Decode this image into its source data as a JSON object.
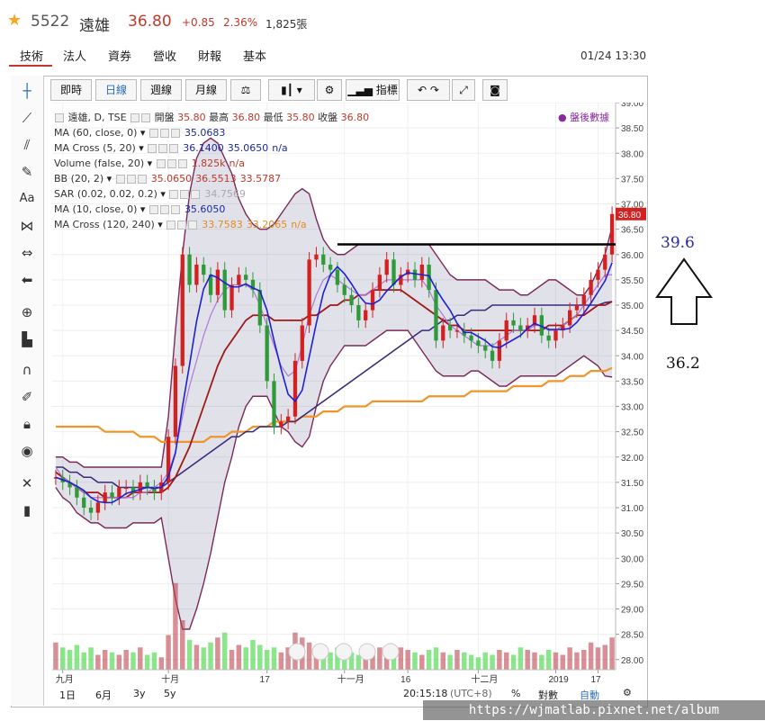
{
  "header": {
    "code": "5522",
    "name": "遠雄",
    "price": "36.80",
    "change": "+0.85",
    "pct": "2.36%",
    "volume": "1,825張",
    "timestamp": "01/24 13:30"
  },
  "tabs": [
    "技術",
    "法人",
    "資券",
    "營收",
    "財報",
    "基本"
  ],
  "toolbar": {
    "buttons": [
      "即時",
      "日線",
      "週線",
      "月線"
    ],
    "indicators": "指標"
  },
  "legend": {
    "title_name": "遠雄, D, TSE",
    "open_l": "開盤",
    "open_v": "35.80",
    "high_l": "最高",
    "high_v": "36.80",
    "low_l": "最低",
    "low_v": "35.80",
    "close_l": "收盤",
    "close_v": "36.80",
    "rows": [
      {
        "label": "MA (60, close, 0)",
        "values": [
          "35.0683"
        ],
        "cls": "vb"
      },
      {
        "label": "MA Cross (5, 20)",
        "values": [
          "36.1400",
          "35.0650",
          "n/a"
        ],
        "cls": "vb"
      },
      {
        "label": "Volume (false, 20)",
        "values": [
          "1.825k",
          "n/a"
        ],
        "cls": "v"
      },
      {
        "label": "BB (20, 2)",
        "values": [
          "35.0650",
          "36.5513",
          "33.5787"
        ],
        "cls": "v"
      },
      {
        "label": "SAR (0.02, 0.02, 0.2)",
        "values": [
          "34.7569"
        ],
        "cls": "vg"
      },
      {
        "label": "MA (10, close, 0)",
        "values": [
          "35.6050"
        ],
        "cls": "vb"
      },
      {
        "label": "MA Cross (120, 240)",
        "values": [
          "33.7583",
          "33.2065",
          "n/a"
        ],
        "cls": "vo"
      }
    ],
    "after_hours": "盤後數據"
  },
  "annotations": {
    "upper": "39.6",
    "lower": "36.2"
  },
  "bottom": {
    "ranges": [
      "1日",
      "6月",
      "3y",
      "5y"
    ],
    "time": "20:15:18",
    "tz": "(UTC+8)",
    "pct": "%",
    "log": "對數",
    "auto": "自動"
  },
  "watermark": "https://wjmatlab.pixnet.net/album",
  "chart_data": {
    "type": "line",
    "title": "遠雄, D, TSE",
    "ylim": [
      27.8,
      39.0
    ],
    "y_ticks": [
      "39.00",
      "38.50",
      "38.00",
      "37.50",
      "37.00",
      "36.50",
      "36.00",
      "35.50",
      "35.00",
      "34.50",
      "34.00",
      "33.50",
      "33.00",
      "32.50",
      "32.00",
      "31.50",
      "31.00",
      "30.50",
      "30.00",
      "29.50",
      "29.00",
      "28.50",
      "28.00"
    ],
    "x_ticks": [
      "九月",
      "十月",
      "17",
      "十一月",
      "16",
      "十二月",
      "2019",
      "17"
    ],
    "last_price_label": "36.80",
    "close": [
      31.6,
      31.5,
      31.4,
      31.2,
      31.0,
      30.9,
      31.1,
      31.3,
      31.2,
      31.4,
      31.4,
      31.3,
      31.5,
      31.4,
      31.3,
      31.5,
      32.4,
      33.8,
      36.0,
      35.4,
      35.8,
      35.6,
      35.2,
      35.7,
      34.9,
      35.4,
      35.6,
      35.5,
      35.3,
      34.6,
      33.5,
      32.6,
      32.7,
      32.8,
      33.9,
      34.6,
      35.9,
      36.0,
      35.8,
      35.7,
      35.4,
      35.2,
      35.0,
      34.7,
      34.9,
      35.3,
      35.6,
      35.9,
      35.4,
      35.6,
      35.7,
      35.5,
      35.8,
      35.3,
      34.3,
      34.6,
      34.5,
      34.5,
      34.4,
      34.3,
      34.2,
      34.1,
      33.9,
      34.3,
      34.7,
      34.6,
      34.5,
      34.6,
      34.8,
      34.4,
      34.3,
      34.5,
      34.6,
      34.9,
      35.0,
      35.2,
      35.5,
      35.7,
      36.0,
      36.8
    ],
    "ma10": [
      31.8,
      31.6,
      31.5,
      31.4,
      31.3,
      31.2,
      31.2,
      31.2,
      31.2,
      31.2,
      31.2,
      31.2,
      31.3,
      31.3,
      31.4,
      31.5,
      31.7,
      32.1,
      32.8,
      33.4,
      33.9,
      34.4,
      34.8,
      35.1,
      35.3,
      35.4,
      35.4,
      35.4,
      35.3,
      35.0,
      34.6,
      34.2,
      33.8,
      33.6,
      33.7,
      34.2,
      34.8,
      35.2,
      35.5,
      35.6,
      35.5,
      35.4,
      35.3,
      35.2,
      35.2,
      35.3,
      35.4,
      35.5,
      35.5,
      35.5,
      35.5,
      35.5,
      35.5,
      35.3,
      35.0,
      34.8,
      34.6,
      34.5,
      34.4,
      34.3,
      34.2,
      34.2,
      34.2,
      34.3,
      34.4,
      34.5,
      34.5,
      34.5,
      34.6,
      34.6,
      34.5,
      34.5,
      34.6,
      34.7,
      34.8,
      35.0,
      35.2,
      35.4,
      35.6,
      35.6
    ],
    "ma20": [
      31.7,
      31.6,
      31.5,
      31.4,
      31.3,
      31.3,
      31.3,
      31.2,
      31.2,
      31.2,
      31.2,
      31.3,
      31.3,
      31.3,
      31.3,
      31.3,
      31.4,
      31.6,
      31.9,
      32.2,
      32.6,
      33.0,
      33.4,
      33.8,
      34.1,
      34.3,
      34.5,
      34.7,
      34.8,
      34.8,
      34.8,
      34.7,
      34.7,
      34.7,
      34.7,
      34.7,
      34.8,
      34.8,
      34.9,
      35.0,
      35.0,
      35.1,
      35.1,
      35.2,
      35.2,
      35.3,
      35.3,
      35.3,
      35.3,
      35.3,
      35.2,
      35.1,
      35.0,
      34.9,
      34.8,
      34.7,
      34.6,
      34.6,
      34.5,
      34.5,
      34.5,
      34.5,
      34.5,
      34.5,
      34.5,
      34.5,
      34.5,
      34.5,
      34.5,
      34.5,
      34.6,
      34.6,
      34.6,
      34.7,
      34.8,
      34.8,
      34.9,
      35.0,
      35.0,
      35.07
    ],
    "ma60": [
      31.8,
      31.8,
      31.7,
      31.7,
      31.6,
      31.6,
      31.5,
      31.5,
      31.5,
      31.4,
      31.4,
      31.4,
      31.4,
      31.4,
      31.4,
      31.4,
      31.5,
      31.6,
      31.7,
      31.8,
      31.9,
      32.0,
      32.1,
      32.2,
      32.3,
      32.4,
      32.4,
      32.5,
      32.5,
      32.6,
      32.6,
      32.6,
      32.6,
      32.7,
      32.7,
      32.8,
      32.9,
      33.0,
      33.1,
      33.2,
      33.3,
      33.4,
      33.5,
      33.6,
      33.7,
      33.8,
      33.9,
      34.0,
      34.1,
      34.2,
      34.3,
      34.4,
      34.5,
      34.5,
      34.6,
      34.7,
      34.7,
      34.8,
      34.8,
      34.9,
      34.9,
      34.9,
      35.0,
      35.0,
      35.0,
      35.0,
      35.0,
      35.0,
      35.0,
      35.0,
      35.0,
      35.0,
      35.0,
      35.0,
      35.0,
      35.0,
      35.0,
      35.0,
      35.05,
      35.07
    ],
    "ma120": [
      32.6,
      32.6,
      32.6,
      32.6,
      32.6,
      32.6,
      32.6,
      32.5,
      32.5,
      32.5,
      32.5,
      32.5,
      32.4,
      32.4,
      32.4,
      32.3,
      32.3,
      32.3,
      32.3,
      32.3,
      32.3,
      32.3,
      32.4,
      32.4,
      32.4,
      32.5,
      32.5,
      32.5,
      32.6,
      32.6,
      32.6,
      32.7,
      32.7,
      32.7,
      32.7,
      32.8,
      32.8,
      32.8,
      32.9,
      32.9,
      32.9,
      33.0,
      33.0,
      33.0,
      33.0,
      33.1,
      33.1,
      33.1,
      33.1,
      33.1,
      33.1,
      33.1,
      33.1,
      33.2,
      33.2,
      33.2,
      33.2,
      33.2,
      33.2,
      33.3,
      33.3,
      33.3,
      33.3,
      33.3,
      33.3,
      33.4,
      33.4,
      33.4,
      33.4,
      33.4,
      33.5,
      33.5,
      33.5,
      33.6,
      33.6,
      33.6,
      33.7,
      33.7,
      33.7,
      33.76
    ],
    "bb_upper": [
      32.0,
      32.0,
      31.9,
      31.9,
      31.8,
      31.8,
      31.8,
      31.8,
      31.8,
      31.8,
      31.8,
      31.8,
      31.8,
      31.8,
      31.8,
      31.8,
      32.8,
      34.5,
      36.0,
      37.2,
      37.9,
      38.2,
      38.3,
      38.2,
      37.9,
      37.6,
      37.1,
      36.8,
      36.6,
      36.5,
      36.5,
      36.6,
      36.8,
      37.0,
      37.2,
      37.3,
      37.2,
      36.7,
      36.3,
      36.1,
      36.0,
      36.0,
      36.1,
      36.2,
      36.2,
      36.2,
      36.2,
      36.2,
      36.2,
      36.2,
      36.2,
      36.2,
      36.2,
      36.2,
      36.0,
      35.8,
      35.6,
      35.5,
      35.5,
      35.5,
      35.5,
      35.5,
      35.4,
      35.3,
      35.3,
      35.3,
      35.2,
      35.2,
      35.3,
      35.4,
      35.5,
      35.5,
      35.4,
      35.3,
      35.2,
      35.2,
      35.4,
      35.7,
      36.0,
      36.55
    ],
    "bb_lower": [
      31.4,
      31.2,
      31.1,
      30.9,
      30.8,
      30.7,
      30.7,
      30.6,
      30.6,
      30.6,
      30.6,
      30.7,
      30.7,
      30.7,
      30.7,
      30.8,
      30.0,
      29.2,
      28.6,
      28.6,
      29.0,
      29.5,
      30.1,
      30.8,
      31.5,
      32.0,
      32.6,
      33.0,
      33.2,
      33.2,
      33.2,
      32.9,
      32.6,
      32.5,
      32.3,
      32.2,
      32.4,
      33.0,
      33.5,
      33.8,
      34.0,
      34.2,
      34.2,
      34.2,
      34.2,
      34.3,
      34.4,
      34.5,
      34.5,
      34.5,
      34.5,
      34.3,
      34.1,
      33.9,
      33.7,
      33.6,
      33.6,
      33.6,
      33.6,
      33.7,
      33.7,
      33.6,
      33.5,
      33.4,
      33.4,
      33.5,
      33.6,
      33.6,
      33.6,
      33.6,
      33.6,
      33.6,
      33.7,
      33.8,
      33.9,
      34.0,
      33.9,
      33.8,
      33.6,
      33.58
    ],
    "volume": [
      1.1,
      0.9,
      0.8,
      1.0,
      0.7,
      0.9,
      0.6,
      0.8,
      0.7,
      0.6,
      0.8,
      0.7,
      0.9,
      0.6,
      0.7,
      0.5,
      1.4,
      3.5,
      2.0,
      1.2,
      1.0,
      0.9,
      1.1,
      1.3,
      1.5,
      0.8,
      1.0,
      0.9,
      1.2,
      1.0,
      0.8,
      0.9,
      0.7,
      0.9,
      1.5,
      1.3,
      1.1,
      0.9,
      0.8,
      0.7,
      0.9,
      0.8,
      0.7,
      0.6,
      0.8,
      0.7,
      0.9,
      0.8,
      0.7,
      0.9,
      0.8,
      0.7,
      0.6,
      0.8,
      0.9,
      0.7,
      0.6,
      0.8,
      0.7,
      0.6,
      0.5,
      0.7,
      0.6,
      0.8,
      0.7,
      0.6,
      0.9,
      0.8,
      0.7,
      0.6,
      0.8,
      0.7,
      0.6,
      0.9,
      0.7,
      0.8,
      1.1,
      0.9,
      1.0,
      1.3
    ]
  }
}
